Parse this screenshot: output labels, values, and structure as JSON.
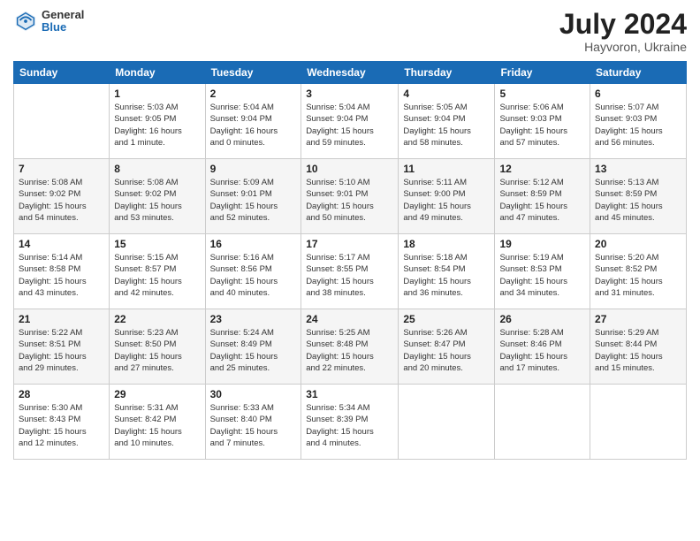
{
  "header": {
    "logo_general": "General",
    "logo_blue": "Blue",
    "month_year": "July 2024",
    "location": "Hayvoron, Ukraine"
  },
  "calendar": {
    "days_of_week": [
      "Sunday",
      "Monday",
      "Tuesday",
      "Wednesday",
      "Thursday",
      "Friday",
      "Saturday"
    ],
    "weeks": [
      [
        {
          "day": "",
          "info": ""
        },
        {
          "day": "1",
          "info": "Sunrise: 5:03 AM\nSunset: 9:05 PM\nDaylight: 16 hours\nand 1 minute."
        },
        {
          "day": "2",
          "info": "Sunrise: 5:04 AM\nSunset: 9:04 PM\nDaylight: 16 hours\nand 0 minutes."
        },
        {
          "day": "3",
          "info": "Sunrise: 5:04 AM\nSunset: 9:04 PM\nDaylight: 15 hours\nand 59 minutes."
        },
        {
          "day": "4",
          "info": "Sunrise: 5:05 AM\nSunset: 9:04 PM\nDaylight: 15 hours\nand 58 minutes."
        },
        {
          "day": "5",
          "info": "Sunrise: 5:06 AM\nSunset: 9:03 PM\nDaylight: 15 hours\nand 57 minutes."
        },
        {
          "day": "6",
          "info": "Sunrise: 5:07 AM\nSunset: 9:03 PM\nDaylight: 15 hours\nand 56 minutes."
        }
      ],
      [
        {
          "day": "7",
          "info": "Sunrise: 5:08 AM\nSunset: 9:02 PM\nDaylight: 15 hours\nand 54 minutes."
        },
        {
          "day": "8",
          "info": "Sunrise: 5:08 AM\nSunset: 9:02 PM\nDaylight: 15 hours\nand 53 minutes."
        },
        {
          "day": "9",
          "info": "Sunrise: 5:09 AM\nSunset: 9:01 PM\nDaylight: 15 hours\nand 52 minutes."
        },
        {
          "day": "10",
          "info": "Sunrise: 5:10 AM\nSunset: 9:01 PM\nDaylight: 15 hours\nand 50 minutes."
        },
        {
          "day": "11",
          "info": "Sunrise: 5:11 AM\nSunset: 9:00 PM\nDaylight: 15 hours\nand 49 minutes."
        },
        {
          "day": "12",
          "info": "Sunrise: 5:12 AM\nSunset: 8:59 PM\nDaylight: 15 hours\nand 47 minutes."
        },
        {
          "day": "13",
          "info": "Sunrise: 5:13 AM\nSunset: 8:59 PM\nDaylight: 15 hours\nand 45 minutes."
        }
      ],
      [
        {
          "day": "14",
          "info": "Sunrise: 5:14 AM\nSunset: 8:58 PM\nDaylight: 15 hours\nand 43 minutes."
        },
        {
          "day": "15",
          "info": "Sunrise: 5:15 AM\nSunset: 8:57 PM\nDaylight: 15 hours\nand 42 minutes."
        },
        {
          "day": "16",
          "info": "Sunrise: 5:16 AM\nSunset: 8:56 PM\nDaylight: 15 hours\nand 40 minutes."
        },
        {
          "day": "17",
          "info": "Sunrise: 5:17 AM\nSunset: 8:55 PM\nDaylight: 15 hours\nand 38 minutes."
        },
        {
          "day": "18",
          "info": "Sunrise: 5:18 AM\nSunset: 8:54 PM\nDaylight: 15 hours\nand 36 minutes."
        },
        {
          "day": "19",
          "info": "Sunrise: 5:19 AM\nSunset: 8:53 PM\nDaylight: 15 hours\nand 34 minutes."
        },
        {
          "day": "20",
          "info": "Sunrise: 5:20 AM\nSunset: 8:52 PM\nDaylight: 15 hours\nand 31 minutes."
        }
      ],
      [
        {
          "day": "21",
          "info": "Sunrise: 5:22 AM\nSunset: 8:51 PM\nDaylight: 15 hours\nand 29 minutes."
        },
        {
          "day": "22",
          "info": "Sunrise: 5:23 AM\nSunset: 8:50 PM\nDaylight: 15 hours\nand 27 minutes."
        },
        {
          "day": "23",
          "info": "Sunrise: 5:24 AM\nSunset: 8:49 PM\nDaylight: 15 hours\nand 25 minutes."
        },
        {
          "day": "24",
          "info": "Sunrise: 5:25 AM\nSunset: 8:48 PM\nDaylight: 15 hours\nand 22 minutes."
        },
        {
          "day": "25",
          "info": "Sunrise: 5:26 AM\nSunset: 8:47 PM\nDaylight: 15 hours\nand 20 minutes."
        },
        {
          "day": "26",
          "info": "Sunrise: 5:28 AM\nSunset: 8:46 PM\nDaylight: 15 hours\nand 17 minutes."
        },
        {
          "day": "27",
          "info": "Sunrise: 5:29 AM\nSunset: 8:44 PM\nDaylight: 15 hours\nand 15 minutes."
        }
      ],
      [
        {
          "day": "28",
          "info": "Sunrise: 5:30 AM\nSunset: 8:43 PM\nDaylight: 15 hours\nand 12 minutes."
        },
        {
          "day": "29",
          "info": "Sunrise: 5:31 AM\nSunset: 8:42 PM\nDaylight: 15 hours\nand 10 minutes."
        },
        {
          "day": "30",
          "info": "Sunrise: 5:33 AM\nSunset: 8:40 PM\nDaylight: 15 hours\nand 7 minutes."
        },
        {
          "day": "31",
          "info": "Sunrise: 5:34 AM\nSunset: 8:39 PM\nDaylight: 15 hours\nand 4 minutes."
        },
        {
          "day": "",
          "info": ""
        },
        {
          "day": "",
          "info": ""
        },
        {
          "day": "",
          "info": ""
        }
      ]
    ]
  }
}
